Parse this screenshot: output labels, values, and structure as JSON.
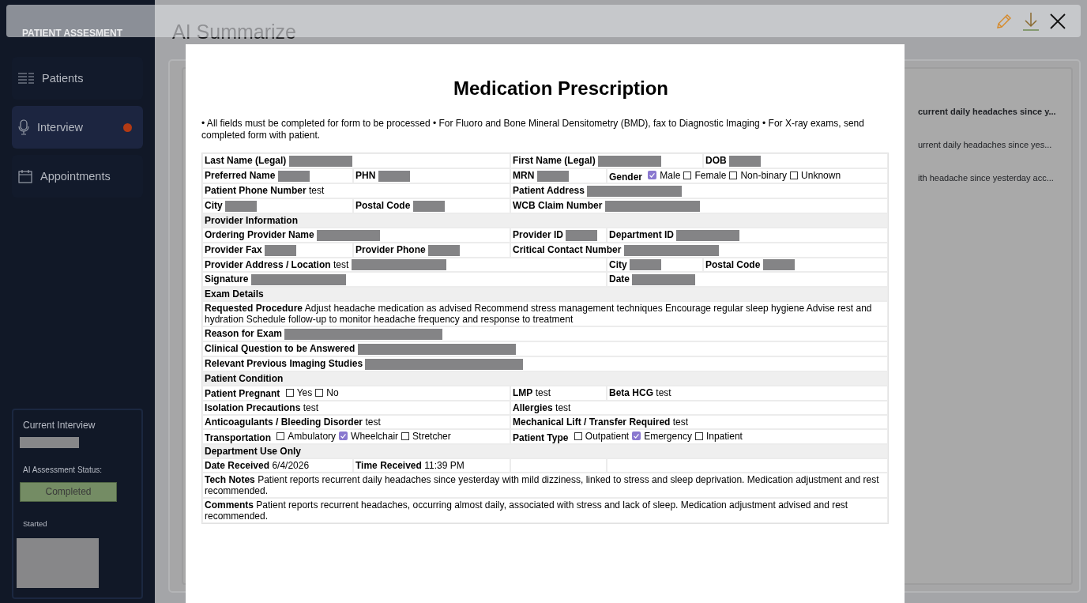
{
  "sidebar": {
    "title": "PATIENT ASSESMENT",
    "items": [
      {
        "label": "Patients",
        "selected": false,
        "alert": false
      },
      {
        "label": "Interview",
        "selected": true,
        "alert": true
      },
      {
        "label": "Appointments",
        "selected": false,
        "alert": false
      }
    ],
    "current_interview": {
      "title": "Current Interview",
      "status_label": "AI Assessment Status:",
      "status": "Completed",
      "started_label": "Started"
    }
  },
  "main": {
    "title": "AI Summarize",
    "snippets": [
      {
        "text": "current daily headaches since y...",
        "bold": true
      },
      {
        "text": "urrent daily headaches since yes...",
        "bold": false
      },
      {
        "text": "ith headache since yesterday acc...",
        "bold": false
      }
    ]
  },
  "toolbar": {
    "actions": [
      {
        "kind": "edit"
      },
      {
        "kind": "download"
      },
      {
        "kind": "close"
      }
    ]
  },
  "document": {
    "title": "Medication Prescription",
    "note": "• All fields must be completed for form to be processed • For Fluoro and Bone Mineral Densitometry (BMD), fax to Diagnostic Imaging • For X-ray exams, send completed form with patient.",
    "rows": [
      {
        "kind": "cells",
        "cells": [
          {
            "label": "Last Name (Legal)",
            "redacted": true
          },
          {
            "label": "First Name (Legal)",
            "redacted": true
          },
          {
            "label": "DOB",
            "redacted": true
          }
        ]
      },
      {
        "kind": "cells",
        "cells": [
          {
            "label": "Preferred Name",
            "redacted": true
          },
          {
            "label": "PHN",
            "redacted": true
          },
          {
            "label": "MRN",
            "redacted": true
          },
          {
            "label": "Gender",
            "options": [
              {
                "label": "Male",
                "checked": true
              },
              {
                "label": "Female",
                "checked": false
              },
              {
                "label": "Non-binary",
                "checked": false
              },
              {
                "label": "Unknown",
                "checked": false
              }
            ]
          }
        ]
      },
      {
        "kind": "cells",
        "cells": [
          {
            "label": "Patient Phone Number",
            "value": "test"
          },
          {
            "label": "Patient Address",
            "redacted": true
          }
        ]
      },
      {
        "kind": "cells",
        "cells": [
          {
            "label": "City",
            "redacted": true
          },
          {
            "label": "Postal Code",
            "redacted": true
          },
          {
            "label": "WCB Claim Number",
            "redacted": true
          }
        ]
      },
      {
        "kind": "section",
        "label": "Provider Information"
      },
      {
        "kind": "cells",
        "cells": [
          {
            "label": "Ordering Provider Name",
            "redacted": true
          },
          {
            "label": "Provider ID",
            "redacted": true
          },
          {
            "label": "Department ID",
            "redacted": true
          }
        ]
      },
      {
        "kind": "cells",
        "cells": [
          {
            "label": "Provider Fax",
            "redacted": true
          },
          {
            "label": "Provider Phone",
            "redacted": true
          },
          {
            "label": "Critical Contact Number",
            "redacted": true
          }
        ]
      },
      {
        "kind": "cells",
        "cells": [
          {
            "label": "Provider Address / Location",
            "value": "test",
            "redacted": true
          },
          {
            "label": "City",
            "redacted": true
          },
          {
            "label": "Postal Code",
            "redacted": true
          }
        ]
      },
      {
        "kind": "cells",
        "cells": [
          {
            "label": "Signature",
            "redacted": true
          },
          {
            "label": "Date",
            "redacted": true
          }
        ]
      },
      {
        "kind": "section",
        "label": "Exam Details"
      },
      {
        "kind": "cells",
        "cells": [
          {
            "label": "Requested Procedure",
            "value": "Adjust headache medication as advised Recommend stress management techniques Encourage regular sleep hygiene Advise rest and hydration Schedule follow-up to monitor headache frequency and response to treatment"
          }
        ]
      },
      {
        "kind": "cells",
        "cells": [
          {
            "label": "Reason for Exam",
            "redacted": true
          }
        ]
      },
      {
        "kind": "cells",
        "cells": [
          {
            "label": "Clinical Question to be Answered",
            "redacted": true
          }
        ]
      },
      {
        "kind": "cells",
        "cells": [
          {
            "label": "Relevant Previous Imaging Studies",
            "redacted": true
          }
        ]
      },
      {
        "kind": "section",
        "label": "Patient Condition"
      },
      {
        "kind": "cells",
        "cells": [
          {
            "label": "Patient Pregnant",
            "options": [
              {
                "label": "Yes",
                "checked": false
              },
              {
                "label": "No",
                "checked": false
              }
            ]
          },
          {
            "label": "LMP",
            "value": "test"
          },
          {
            "label": "Beta HCG",
            "value": "test"
          }
        ]
      },
      {
        "kind": "cells",
        "cells": [
          {
            "label": "Isolation Precautions",
            "value": "test"
          },
          {
            "label": "Allergies",
            "value": "test"
          }
        ]
      },
      {
        "kind": "cells",
        "cells": [
          {
            "label": "Anticoagulants / Bleeding Disorder",
            "value": "test"
          },
          {
            "label": "Mechanical Lift / Transfer Required",
            "value": "test"
          }
        ]
      },
      {
        "kind": "cells",
        "cells": [
          {
            "label": "Transportation",
            "options": [
              {
                "label": "Ambulatory",
                "checked": false
              },
              {
                "label": "Wheelchair",
                "checked": true
              },
              {
                "label": "Stretcher",
                "checked": false
              }
            ]
          },
          {
            "label": "Patient Type",
            "options": [
              {
                "label": "Outpatient",
                "checked": false
              },
              {
                "label": "Emergency",
                "checked": true
              },
              {
                "label": "Inpatient",
                "checked": false
              }
            ]
          }
        ]
      },
      {
        "kind": "section",
        "label": "Department Use Only"
      },
      {
        "kind": "cells",
        "cells": [
          {
            "label": "Date Received",
            "value": "6/4/2026"
          },
          {
            "label": "Time Received",
            "value": "11:39 PM"
          },
          {},
          {}
        ]
      },
      {
        "kind": "cells",
        "cells": [
          {
            "label": "Tech Notes",
            "value": "Patient reports recurrent daily headaches since yesterday with mild dizziness, linked to stress and sleep deprivation. Medication adjustment and rest recommended."
          }
        ]
      },
      {
        "kind": "cells",
        "cells": [
          {
            "label": "Comments",
            "value": "Patient reports recurrent headaches, occurring almost daily, associated with stress and lack of sleep. Medication adjustment advised and rest recommended."
          }
        ]
      }
    ]
  }
}
